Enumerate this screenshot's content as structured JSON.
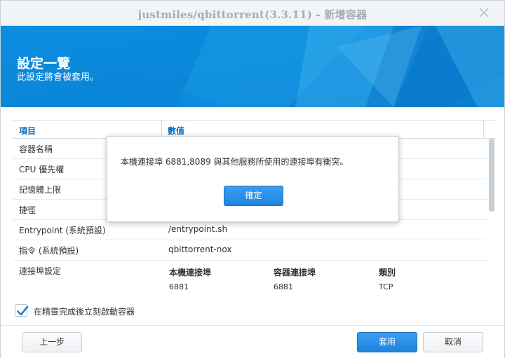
{
  "window": {
    "title": "justmiles/qbittorrent(3.3.11) - 新增容器"
  },
  "banner": {
    "heading": "設定一覽",
    "subheading": "此設定將會被套用。"
  },
  "grid": {
    "col_item": "項目",
    "col_value": "數值",
    "rows": [
      {
        "key": "容器名稱",
        "value": ""
      },
      {
        "key": "CPU 優先權",
        "value": ""
      },
      {
        "key": "記憶體上限",
        "value": ""
      },
      {
        "key": "捷徑",
        "value": ""
      },
      {
        "key": "Entrypoint (系統預設)",
        "value": "/entrypoint.sh"
      },
      {
        "key": "指令 (系統預設)",
        "value": "qbittorrent-nox"
      }
    ],
    "ports": {
      "key": "連接埠設定",
      "headers": [
        "本機連接埠",
        "容器連接埠",
        "類別"
      ],
      "values": [
        "6881",
        "6881",
        "TCP"
      ]
    }
  },
  "auto_start": {
    "label": "在精靈完成後立刻啟動容器",
    "checked": true
  },
  "footer": {
    "back_label": "上一步",
    "apply_label": "套用",
    "cancel_label": "取消"
  },
  "modal": {
    "message": "本機連接埠 6881,8089 與其他服務所使用的連接埠有衝突。",
    "ok_label": "確定"
  },
  "colors": {
    "accent": "#0a8fdc",
    "button_primary": "#2a8fe6",
    "header_text": "#0a6bb8"
  },
  "icons": {
    "close": "close-icon",
    "check": "checkmark-icon"
  }
}
